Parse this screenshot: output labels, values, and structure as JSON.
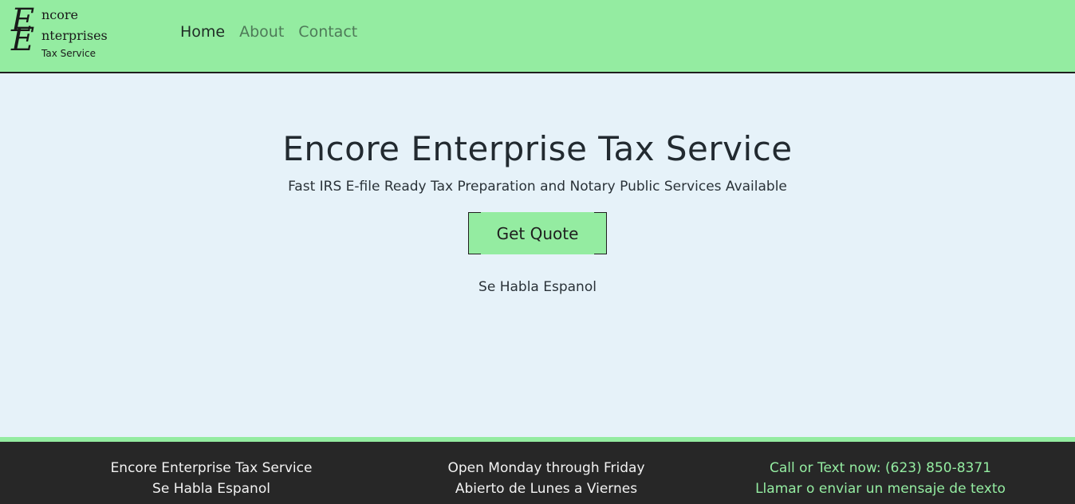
{
  "logo": {
    "line1_initial": "E",
    "line1_word": "ncore",
    "line2_initial": "E",
    "line2_word": "nterprises",
    "subtitle": "Tax Service"
  },
  "nav": {
    "items": [
      {
        "label": "Home",
        "active": true
      },
      {
        "label": "About",
        "active": false
      },
      {
        "label": "Contact",
        "active": false
      }
    ]
  },
  "hero": {
    "title": "Encore Enterprise Tax Service",
    "tagline": "Fast IRS E-file Ready Tax Preparation and Notary Public Services Available",
    "button_label": "Get Quote",
    "note": "Se Habla Espanol"
  },
  "footer": {
    "col1": [
      "Encore Enterprise Tax Service",
      "Se Habla Espanol"
    ],
    "col2": [
      "Open Monday through Friday",
      "Abierto de Lunes a Viernes"
    ],
    "col3": [
      "Call or Text now: (623) 850-8371",
      "Llamar o enviar un mensaje de texto"
    ]
  },
  "colors": {
    "accent_green": "#94eca1",
    "page_background": "#e6f2f9",
    "footer_background": "#272727"
  }
}
